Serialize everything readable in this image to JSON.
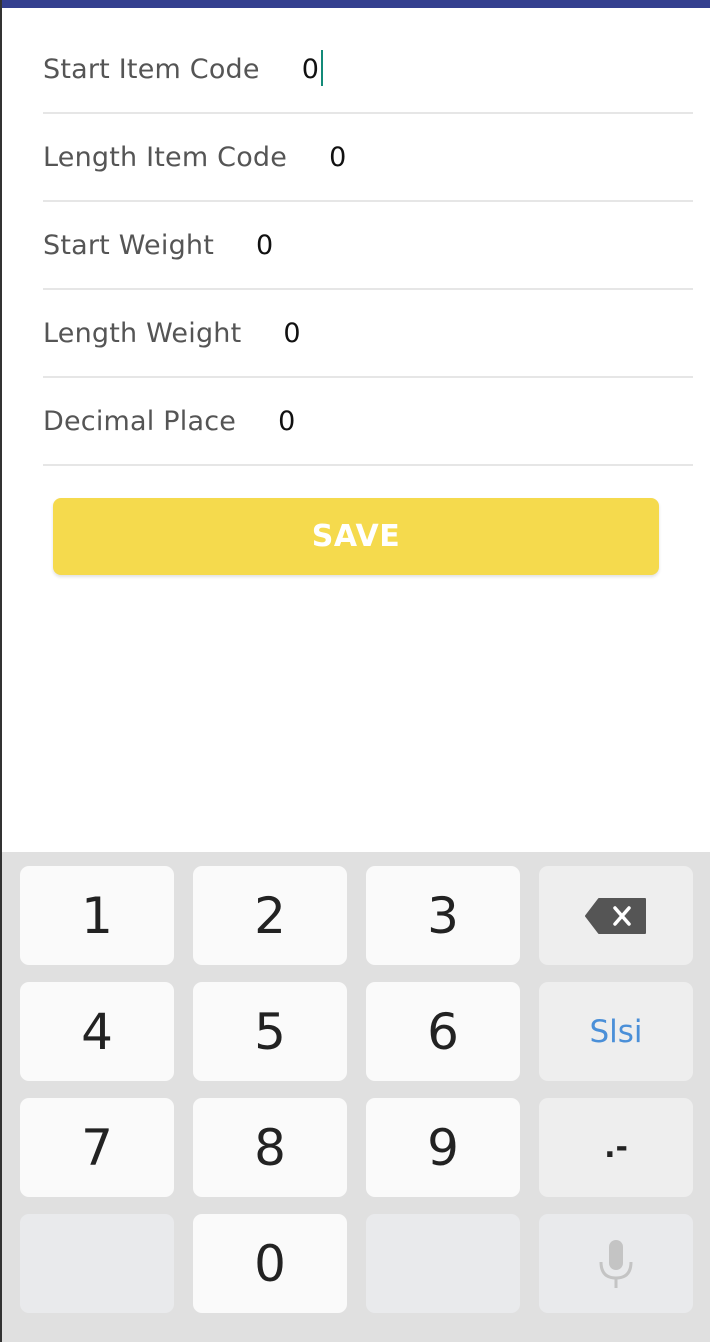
{
  "form": {
    "fields": [
      {
        "label": "Start Item Code",
        "value": "0",
        "focused": true
      },
      {
        "label": "Length Item Code",
        "value": "0"
      },
      {
        "label": "Start Weight",
        "value": "0"
      },
      {
        "label": "Length Weight",
        "value": "0"
      },
      {
        "label": "Decimal Place",
        "value": "0"
      }
    ],
    "save_label": "SAVE"
  },
  "colors": {
    "top_bar": "#34408f",
    "save_button": "#f5da4d",
    "caret": "#138a78",
    "keyboard_bg": "#e0e0e0",
    "lang_key_text": "#4a8fd8"
  },
  "keyboard": {
    "keys": [
      "1",
      "2",
      "3",
      "4",
      "5",
      "6",
      "7",
      "8",
      "9",
      "0"
    ],
    "backspace": "backspace-icon",
    "language_label": "Slsi",
    "symbol_label": ".-",
    "mic": "microphone-icon"
  }
}
